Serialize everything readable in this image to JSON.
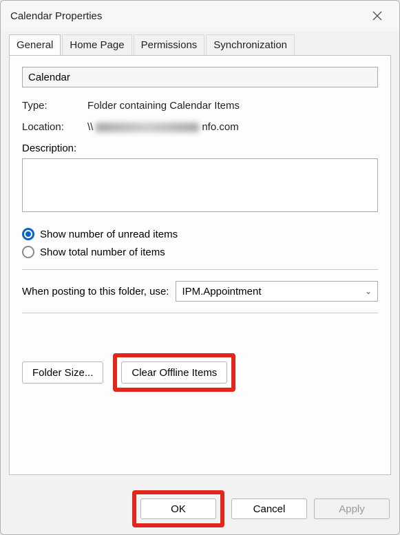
{
  "window": {
    "title": "Calendar Properties"
  },
  "tabs": {
    "general": "General",
    "home": "Home Page",
    "permissions": "Permissions",
    "sync": "Synchronization"
  },
  "general": {
    "name_value": "Calendar",
    "type_label": "Type:",
    "type_value": "Folder containing Calendar Items",
    "location_label": "Location:",
    "location_prefix": "\\\\",
    "location_suffix": "nfo.com",
    "descr_label": "Description:",
    "descr_value": "",
    "radio_unread": "Show number of unread items",
    "radio_total": "Show total number of items",
    "post_label": "When posting to this folder, use:",
    "post_value": "IPM.Appointment",
    "folder_size": "Folder Size...",
    "clear_offline": "Clear Offline Items"
  },
  "buttons": {
    "ok": "OK",
    "cancel": "Cancel",
    "apply": "Apply"
  }
}
